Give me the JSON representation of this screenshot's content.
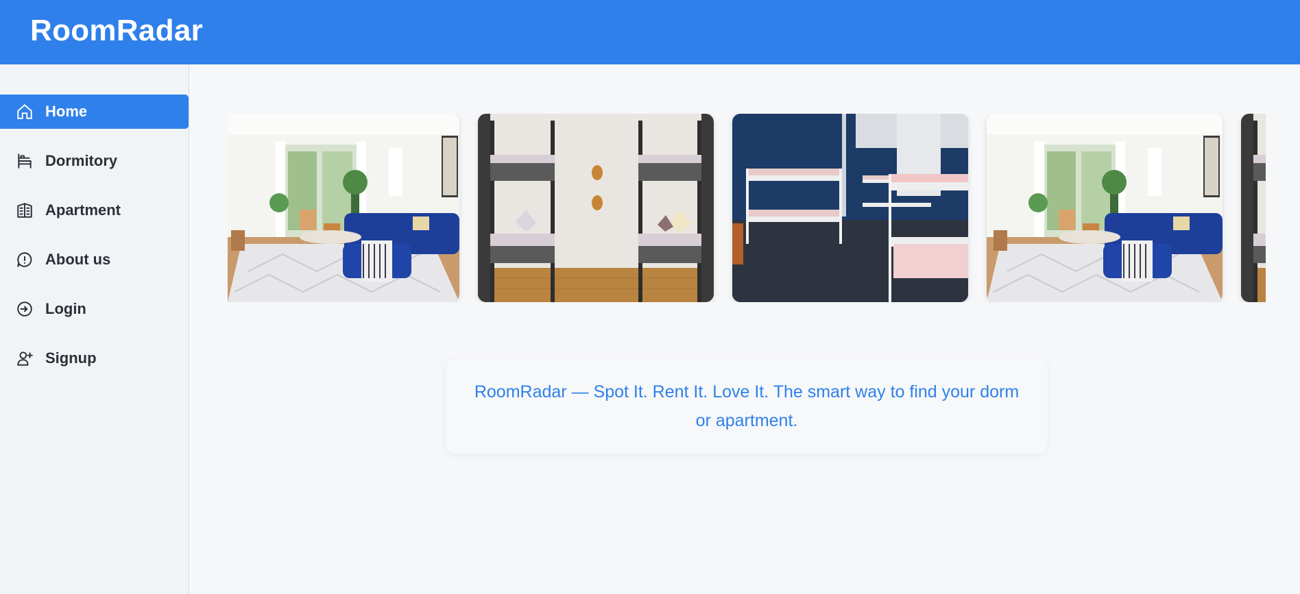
{
  "app": {
    "title": "RoomRadar"
  },
  "sidebar": {
    "items": [
      {
        "label": "Home",
        "icon": "home-icon",
        "active": true
      },
      {
        "label": "Dormitory",
        "icon": "bed-icon",
        "active": false
      },
      {
        "label": "Apartment",
        "icon": "building-icon",
        "active": false
      },
      {
        "label": "About us",
        "icon": "info-circle-icon",
        "active": false
      },
      {
        "label": "Login",
        "icon": "login-icon",
        "active": false
      },
      {
        "label": "Signup",
        "icon": "user-plus-icon",
        "active": false
      }
    ]
  },
  "carousel": {
    "slides": [
      {
        "subject": "living-room"
      },
      {
        "subject": "bunk-beds-wood-floor"
      },
      {
        "subject": "dorm-blue-walls"
      },
      {
        "subject": "living-room"
      },
      {
        "subject": "bunk-beds-wood-floor"
      }
    ]
  },
  "hero": {
    "tagline": "RoomRadar — Spot It. Rent It. Love It. The smart way to find your dorm or apartment."
  },
  "colors": {
    "accent": "#2f80ea",
    "sidebar_bg": "#f1f4f7",
    "page_bg": "#f6f7f9",
    "text_dark": "#2b2f36"
  }
}
